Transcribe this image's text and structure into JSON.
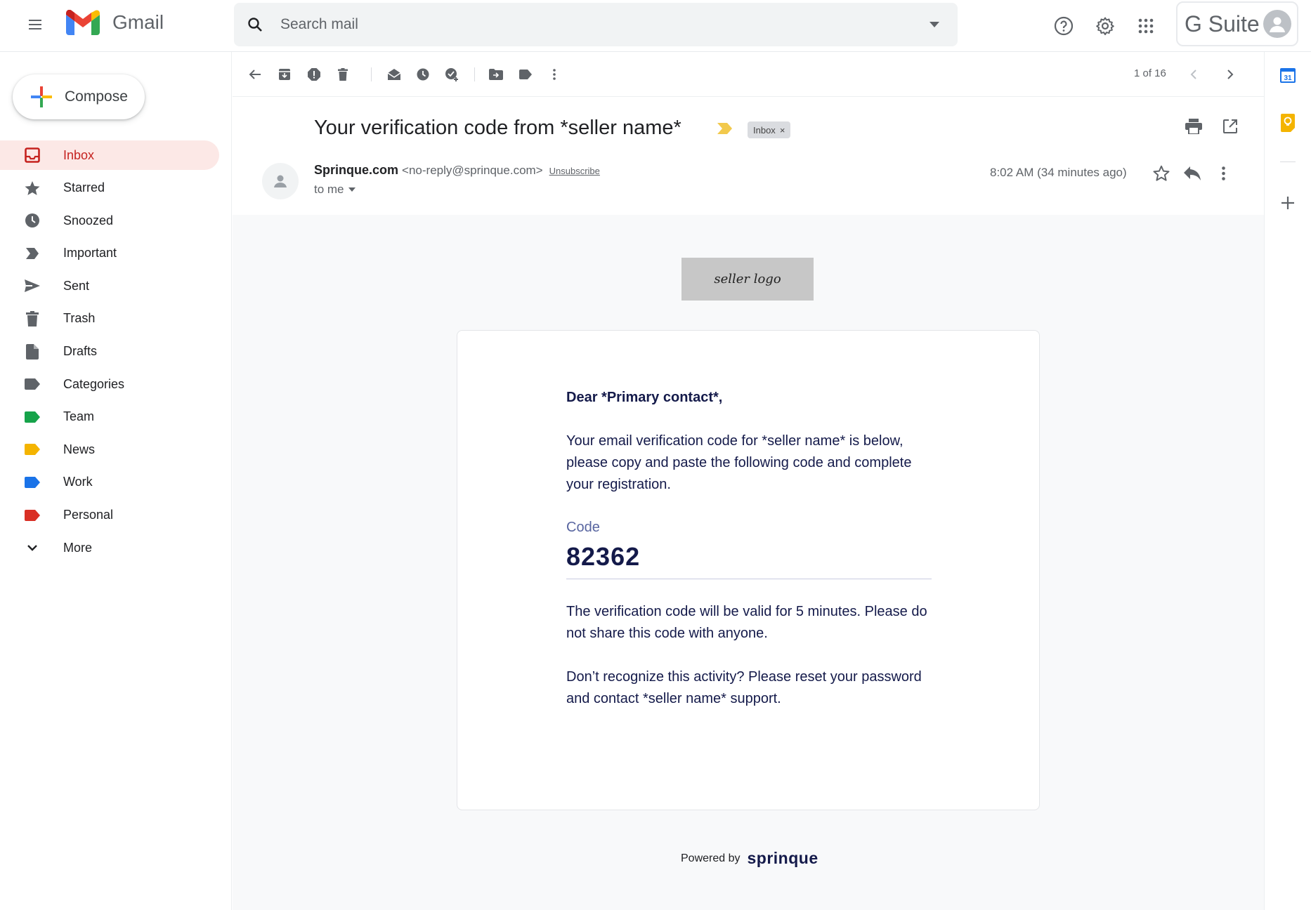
{
  "app": {
    "name": "Gmail"
  },
  "search": {
    "placeholder": "Search mail"
  },
  "account": {
    "brand": "G Suite"
  },
  "compose": {
    "label": "Compose"
  },
  "sidebar": {
    "items": [
      {
        "label": "Inbox",
        "icon": "inbox-icon",
        "active": true
      },
      {
        "label": "Starred",
        "icon": "star-icon"
      },
      {
        "label": "Snoozed",
        "icon": "clock-icon"
      },
      {
        "label": "Important",
        "icon": "important-icon"
      },
      {
        "label": "Sent",
        "icon": "send-icon"
      },
      {
        "label": "Trash",
        "icon": "trash-icon"
      },
      {
        "label": "Drafts",
        "icon": "draft-icon"
      },
      {
        "label": "Categories",
        "icon": "label-icon",
        "color": "#5f6368"
      },
      {
        "label": "Team",
        "icon": "label-icon",
        "color": "#16a34a"
      },
      {
        "label": "News",
        "icon": "label-icon",
        "color": "#f4b400"
      },
      {
        "label": "Work",
        "icon": "label-icon",
        "color": "#1a73e8"
      },
      {
        "label": "Personal",
        "icon": "label-icon",
        "color": "#d93025"
      },
      {
        "label": "More",
        "icon": "chevron-down-icon"
      }
    ]
  },
  "toolbar": {
    "pager": "1 of 16"
  },
  "message": {
    "subject": "Your verification code from *seller name*",
    "label_chip": "Inbox",
    "sender_name": "Sprinque.com",
    "sender_email": "<no-reply@sprinque.com>",
    "unsubscribe": "Unsubscribe",
    "to": "to me",
    "time": "8:02 AM (34 minutes ago)"
  },
  "email": {
    "logo_text": "seller logo",
    "greeting": "Dear *Primary contact*,",
    "intro": "Your email verification code for *seller name* is below, please copy and paste the following code and complete your registration.",
    "code_label": "Code",
    "code": "82362",
    "validity": "The verification code will be valid for 5 minutes. Please do not share this code with anyone.",
    "security": "Don’t recognize this activity? Please reset your password and contact *seller name* support.",
    "powered_by": "Powered by",
    "brand": "sprinque"
  },
  "right_rail": {
    "calendar_day": "31"
  },
  "colors": {
    "accent_red": "#c5221f",
    "active_bg": "#fce8e6",
    "email_text": "#141a4a"
  }
}
